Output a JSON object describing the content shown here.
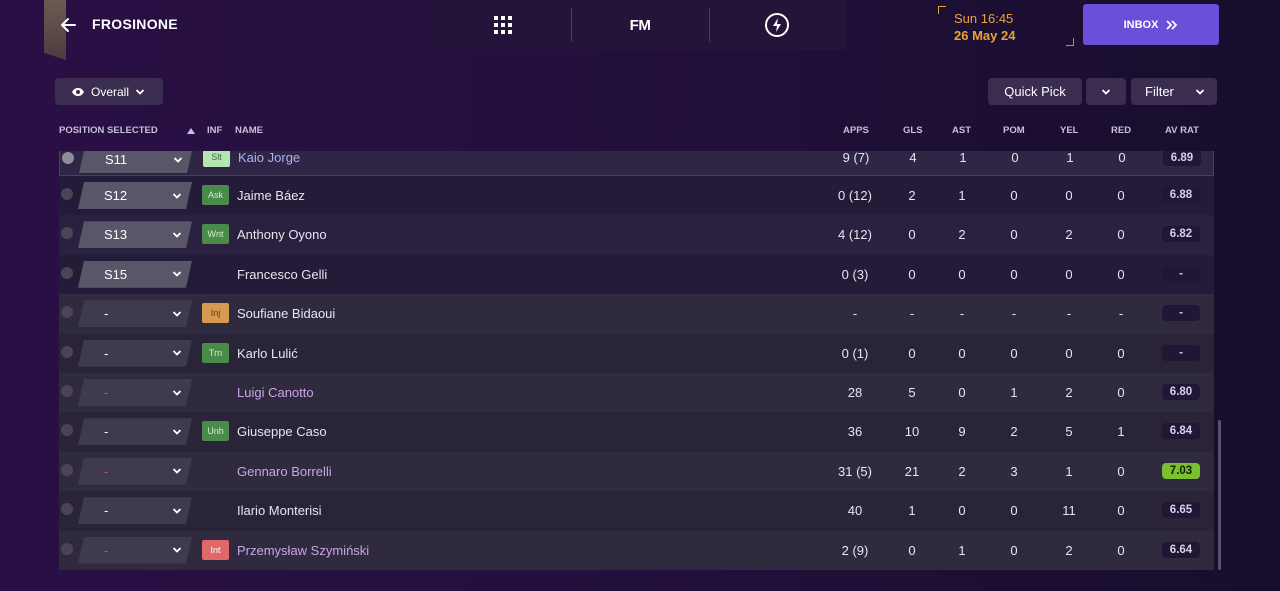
{
  "header": {
    "club_name": "FROSINONE",
    "time": "Sun 16:45",
    "date": "26 May 24",
    "inbox_label": "INBOX",
    "fm_logo": "FM"
  },
  "toolbar": {
    "view_label": "Overall",
    "quick_pick_label": "Quick Pick",
    "filter_label": "Filter"
  },
  "columns": {
    "position": "POSITION SELECTED",
    "inf": "INF",
    "name": "NAME",
    "apps": "APPS",
    "gls": "GLS",
    "ast": "AST",
    "pom": "POM",
    "yel": "YEL",
    "red": "RED",
    "avrat": "AV RAT"
  },
  "rows": [
    {
      "pos": "S11",
      "inf": "Slt",
      "name": "Kaio Jorge",
      "apps": "9 (7)",
      "gls": "4",
      "ast": "1",
      "pom": "0",
      "yel": "1",
      "red": "0",
      "rat": "6.89"
    },
    {
      "pos": "S12",
      "inf": "Ask",
      "name": "Jaime Báez",
      "apps": "0 (12)",
      "gls": "2",
      "ast": "1",
      "pom": "0",
      "yel": "0",
      "red": "0",
      "rat": "6.88"
    },
    {
      "pos": "S13",
      "inf": "Wnt",
      "name": "Anthony Oyono",
      "apps": "4 (12)",
      "gls": "0",
      "ast": "2",
      "pom": "0",
      "yel": "2",
      "red": "0",
      "rat": "6.82"
    },
    {
      "pos": "S15",
      "inf": "",
      "name": "Francesco Gelli",
      "apps": "0 (3)",
      "gls": "0",
      "ast": "0",
      "pom": "0",
      "yel": "0",
      "red": "0",
      "rat": "-"
    },
    {
      "pos": "-",
      "inf": "Inj",
      "name": "Soufiane Bidaoui",
      "apps": "-",
      "gls": "-",
      "ast": "-",
      "pom": "-",
      "yel": "-",
      "red": "-",
      "rat": "-"
    },
    {
      "pos": "-",
      "inf": "Trn",
      "name": "Karlo Lulić",
      "apps": "0 (1)",
      "gls": "0",
      "ast": "0",
      "pom": "0",
      "yel": "0",
      "red": "0",
      "rat": "-"
    },
    {
      "pos": "-",
      "inf": "",
      "name": "Luigi Canotto",
      "apps": "28",
      "gls": "5",
      "ast": "0",
      "pom": "1",
      "yel": "2",
      "red": "0",
      "rat": "6.80"
    },
    {
      "pos": "-",
      "inf": "Unh",
      "name": "Giuseppe Caso",
      "apps": "36",
      "gls": "10",
      "ast": "9",
      "pom": "2",
      "yel": "5",
      "red": "1",
      "rat": "6.84"
    },
    {
      "pos": "-",
      "inf": "",
      "name": "Gennaro Borrelli",
      "apps": "31 (5)",
      "gls": "21",
      "ast": "2",
      "pom": "3",
      "yel": "1",
      "red": "0",
      "rat": "7.03"
    },
    {
      "pos": "-",
      "inf": "",
      "name": "Ilario Monterisi",
      "apps": "40",
      "gls": "1",
      "ast": "0",
      "pom": "0",
      "yel": "11",
      "red": "0",
      "rat": "6.65"
    },
    {
      "pos": "-",
      "inf": "Int",
      "name": "Przemysław Szymiński",
      "apps": "2 (9)",
      "gls": "0",
      "ast": "1",
      "pom": "0",
      "yel": "2",
      "red": "0",
      "rat": "6.64"
    }
  ],
  "colors": {
    "accent": "#6b4fd8",
    "date": "#e9a33a",
    "rating_best": "#7cbf2f"
  }
}
